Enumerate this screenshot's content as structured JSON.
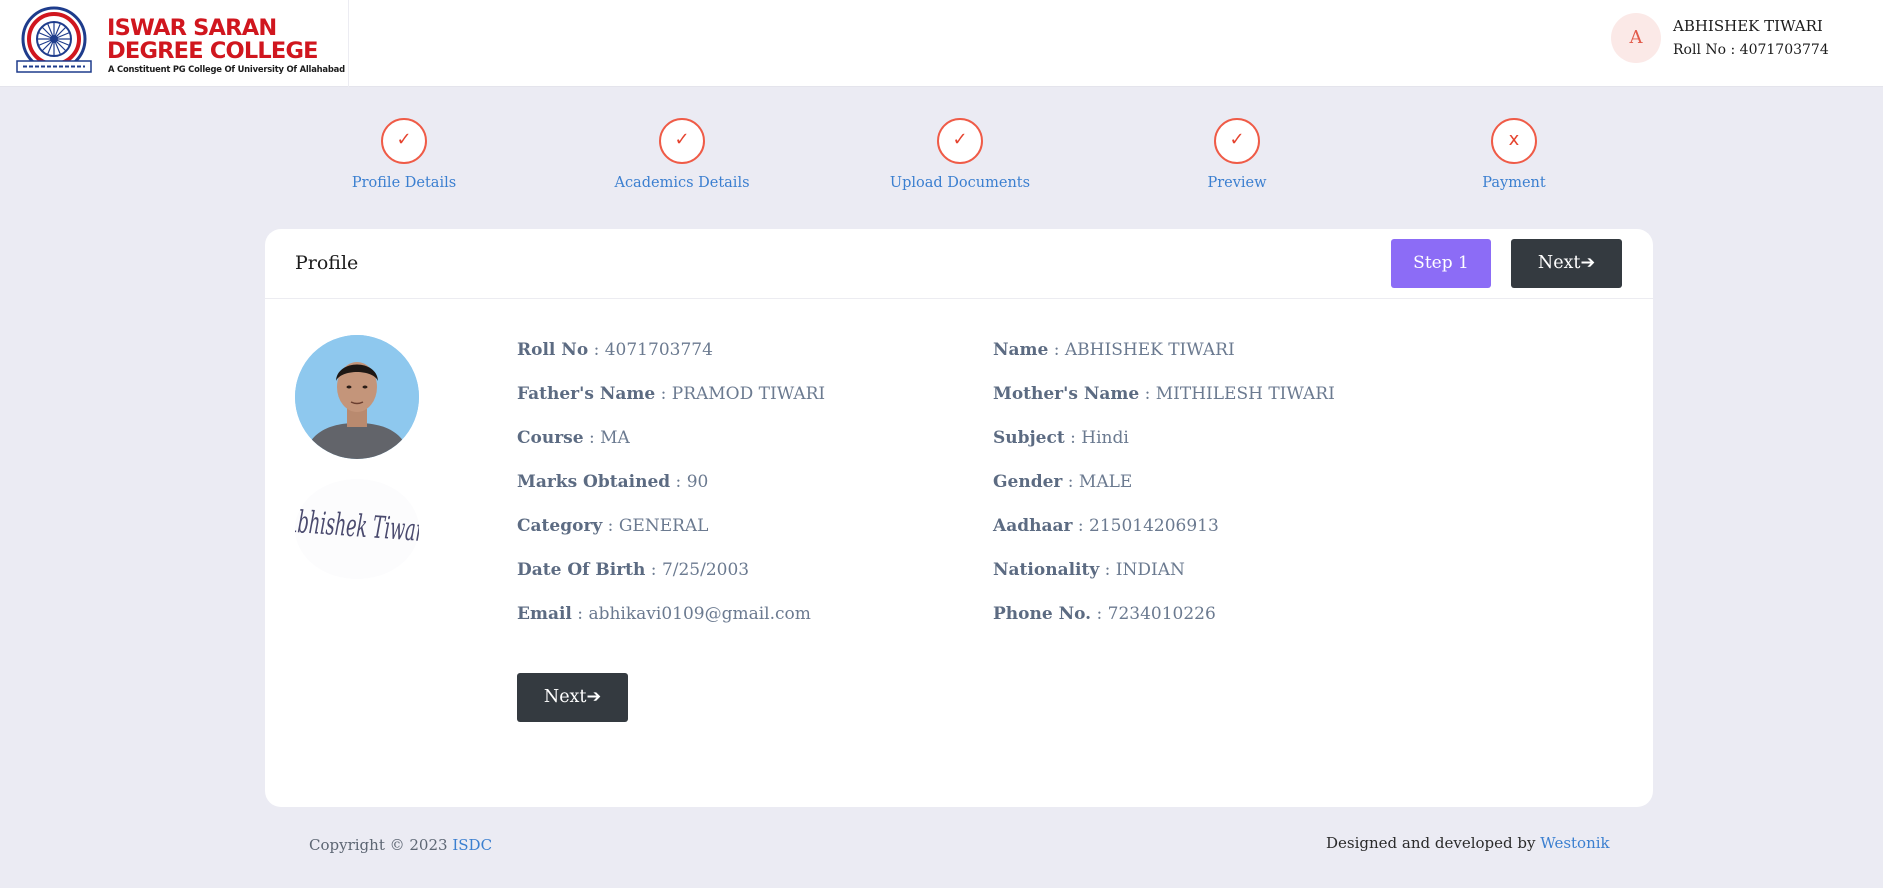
{
  "header": {
    "college_name_line1": "ISWAR SARAN",
    "college_name_line2": "DEGREE COLLEGE",
    "college_subtitle": "A Constituent PG College Of University Of Allahabad",
    "user": {
      "avatar_letter": "A",
      "name": "ABHISHEK TIWARI",
      "roll": "Roll No : 4071703774"
    }
  },
  "steps": [
    {
      "label": "Profile Details",
      "symbol": "✓"
    },
    {
      "label": "Academics Details",
      "symbol": "✓"
    },
    {
      "label": "Upload Documents",
      "symbol": "✓"
    },
    {
      "label": "Preview",
      "symbol": "✓"
    },
    {
      "label": "Payment",
      "symbol": "x"
    }
  ],
  "card": {
    "title": "Profile",
    "step_button": "Step 1",
    "next_button": "Next",
    "arrow": "➔"
  },
  "profile": {
    "left": [
      {
        "key": "Roll No",
        "value": "4071703774"
      },
      {
        "key": "Father's Name",
        "value": "PRAMOD TIWARI"
      },
      {
        "key": "Course",
        "value": "MA"
      },
      {
        "key": "Marks Obtained",
        "value": "90"
      },
      {
        "key": "Category",
        "value": "GENERAL"
      },
      {
        "key": "Date Of Birth",
        "value": "7/25/2003"
      },
      {
        "key": "Email",
        "value": "abhikavi0109@gmail.com"
      }
    ],
    "right": [
      {
        "key": "Name",
        "value": "ABHISHEK TIWARI"
      },
      {
        "key": "Mother's Name",
        "value": "MITHILESH TIWARI"
      },
      {
        "key": "Subject",
        "value": "Hindi"
      },
      {
        "key": "Gender",
        "value": "MALE"
      },
      {
        "key": "Aadhaar",
        "value": "215014206913"
      },
      {
        "key": "Nationality",
        "value": "INDIAN"
      },
      {
        "key": "Phone No.",
        "value": "7234010226"
      }
    ],
    "signature_text": "Abhishek Tiwari"
  },
  "footer": {
    "copyright": "Copyright © 2023",
    "copyright_link": "ISDC",
    "designed_by": "Designed and developed by",
    "designed_link": "Westonik"
  },
  "colors": {
    "accent": "#8c6cf6",
    "step_circle": "#ef5b47",
    "link": "#3b7fd0",
    "dark_button": "#343a40",
    "page_background": "#ebebf3",
    "brand_red": "#d0161e"
  }
}
